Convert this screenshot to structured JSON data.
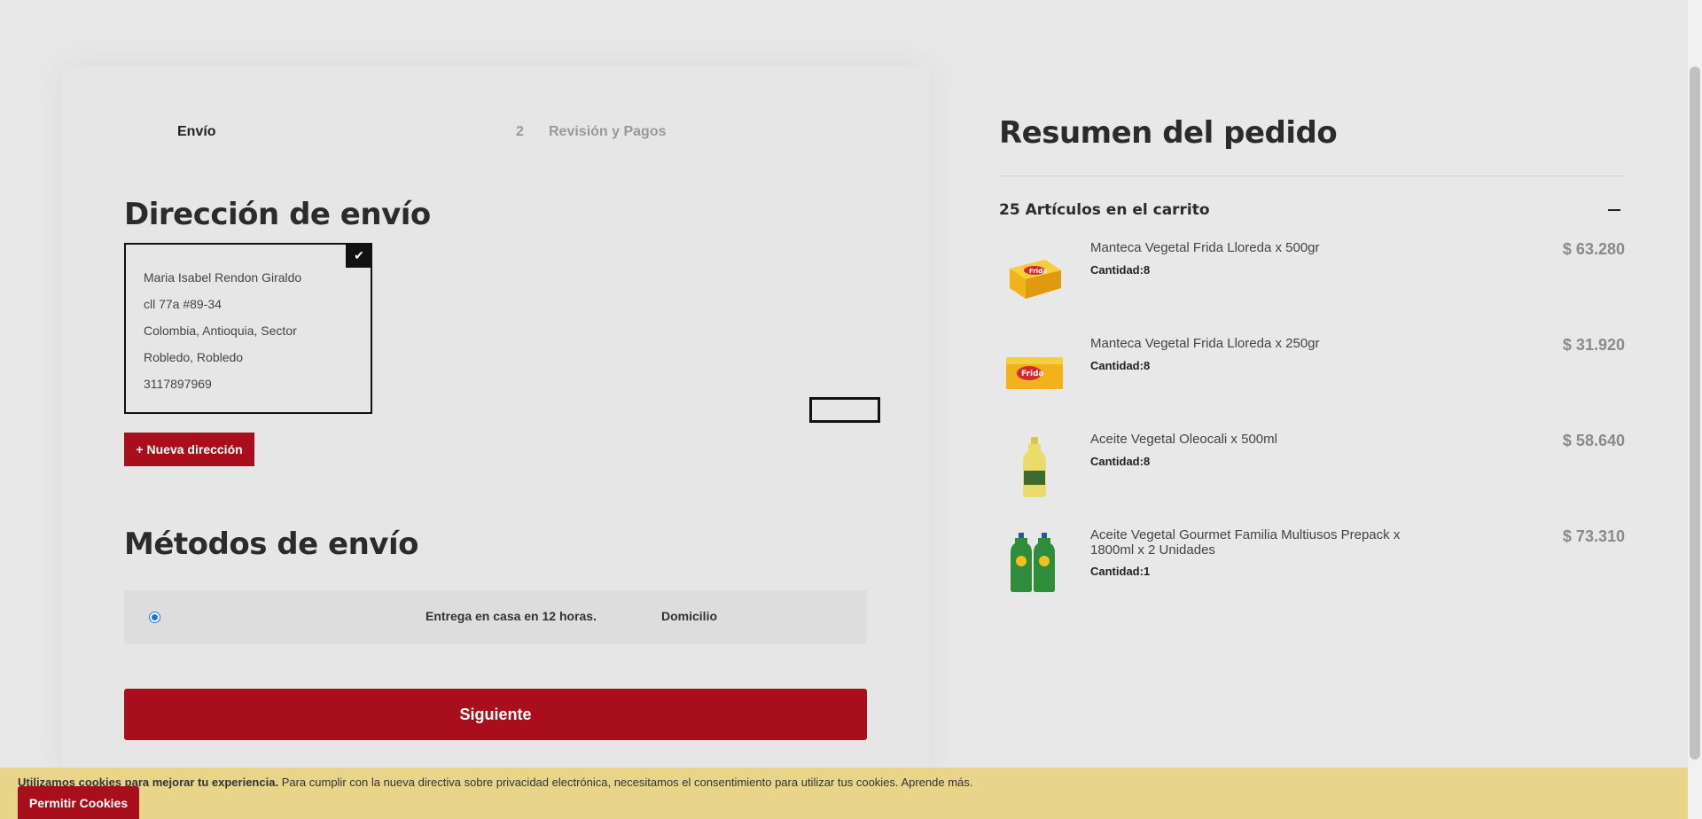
{
  "steps": {
    "step1_label": "Envío",
    "step2_number": "2",
    "step2_label": "Revisión y Pagos"
  },
  "shipping_address": {
    "title": "Dirección de envío",
    "lines": [
      "Maria Isabel Rendon Giraldo",
      "cll 77a #89-34",
      "Colombia, Antioquia, Sector",
      "Robledo, Robledo",
      "3117897969"
    ],
    "new_address_button": "Nueva dirección",
    "new_address_prefix": "+"
  },
  "shipping_methods": {
    "title": "Métodos de envío",
    "option_description": "Entrega en casa en 12 horas.",
    "option_carrier": "Domicilio",
    "selected": true
  },
  "next_button": "Siguiente",
  "order_summary": {
    "title": "Resumen del pedido",
    "cart_count_label": "25 Artículos en el carrito",
    "items": [
      {
        "name": "Manteca Vegetal Frida Lloreda x 500gr",
        "quantity": "Cantidad:8",
        "price": "$ 63.280",
        "icon": "butter-block-500gr"
      },
      {
        "name": "Manteca Vegetal Frida Lloreda x 250gr",
        "quantity": "Cantidad:8",
        "price": "$ 31.920",
        "icon": "butter-block-250gr"
      },
      {
        "name": "Aceite Vegetal Oleocali x 500ml",
        "quantity": "Cantidad:8",
        "price": "$ 58.640",
        "icon": "oil-bottle"
      },
      {
        "name": "Aceite Vegetal Gourmet Familia Multiusos Prepack x 1800ml x 2 Unidades",
        "quantity": "Cantidad:1",
        "price": "$ 73.310",
        "icon": "oil-bottles-pair"
      }
    ]
  },
  "cookie_banner": {
    "bold_text": "Utilizamos cookies para mejorar tu experiencia.",
    "text": "Para cumplir con la nueva directiva sobre privacidad electrónica, necesitamos el consentimiento para utilizar tus cookies.",
    "link": "Aprende más.",
    "button": "Permitir Cookies"
  },
  "colors": {
    "accent": "#a90e1c",
    "background": "#e8e8e8",
    "cookie_bar": "#e8d58a"
  }
}
